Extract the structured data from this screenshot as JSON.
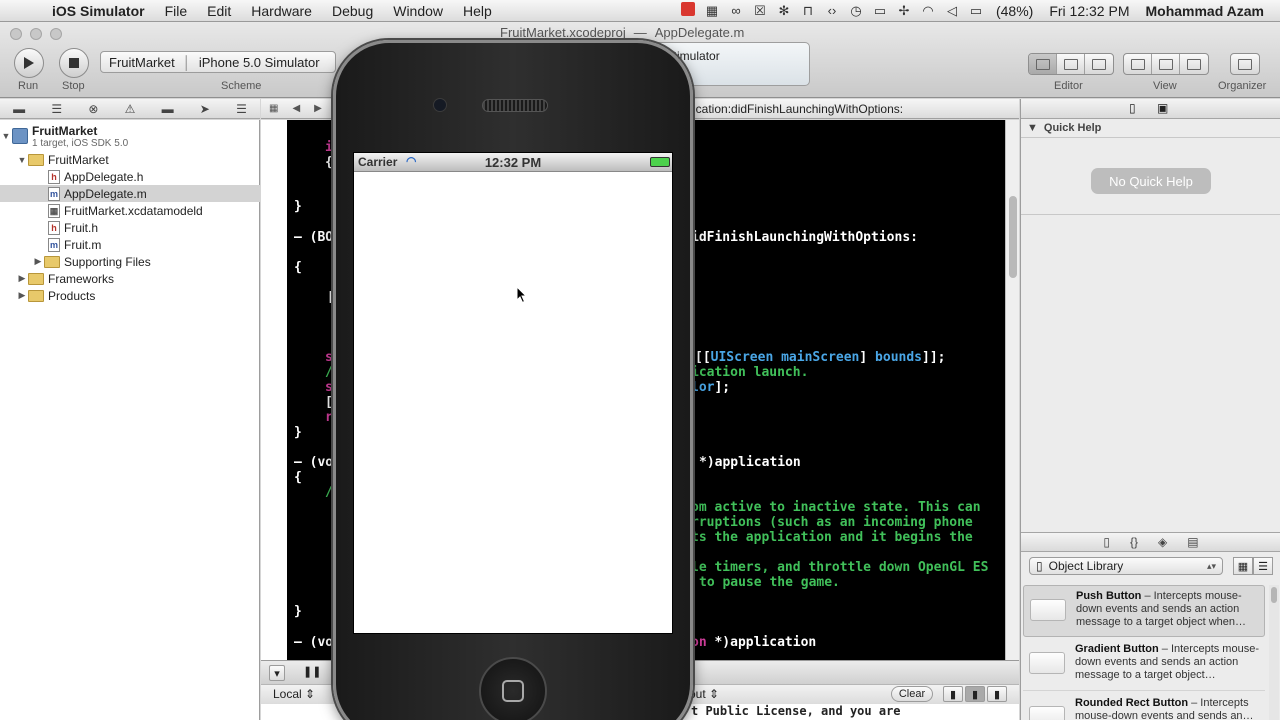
{
  "menubar": {
    "app_name": "iOS Simulator",
    "menus": [
      "File",
      "Edit",
      "Hardware",
      "Debug",
      "Window",
      "Help"
    ],
    "battery": "(48%)",
    "clock": "Fri 12:32 PM",
    "user": "Mohammad Azam"
  },
  "toolbar": {
    "run_label": "Run",
    "stop_label": "Stop",
    "scheme_label": "Scheme",
    "scheme_target": "FruitMarket",
    "scheme_destination": "iPhone 5.0 Simulator",
    "activity_text": "5.0 Simulator",
    "doc_tab_1": "FruitMarket.xcodeproj",
    "doc_tab_sep": "—",
    "doc_tab_2": "AppDelegate.m",
    "editor_label": "Editor",
    "view_label": "View",
    "organizer_label": "Organizer"
  },
  "navigator": {
    "project_name": "FruitMarket",
    "project_sub": "1 target, iOS SDK 5.0",
    "group_name": "FruitMarket",
    "files": [
      {
        "name": "AppDelegate.h",
        "kind": "h"
      },
      {
        "name": "AppDelegate.m",
        "kind": "m"
      },
      {
        "name": "FruitMarket.xcdatamodeld",
        "kind": "d"
      },
      {
        "name": "Fruit.h",
        "kind": "h"
      },
      {
        "name": "Fruit.m",
        "kind": "m"
      }
    ],
    "supporting_files": "Supporting Files",
    "frameworks": "Frameworks",
    "products": "Products"
  },
  "editor": {
    "jump_path": "ication:didFinishLaunchingWithOptions:",
    "code": {
      "l_brace1": "}",
      "l_method1": "– (BO",
      "l_didfinish": "idFinishLaunchingWithOptions:",
      "l_open1": "{",
      "l_bracket": "[",
      "l_screen_open": "[[",
      "l_screen_class": "UIScreen",
      "l_screen_msg": "mainScreen",
      "l_screen_close": "]",
      "l_screen_bounds": "bounds",
      "l_screen_end": "]];",
      "l_comment_launch": "ication launch.",
      "l_color_part": "lor",
      "l_color_end": "];",
      "l_brace2": "}",
      "l_method2": "– (vo",
      "l_app1": "*)application",
      "l_open2": "{",
      "l_c1": "om active to inactive state. This can",
      "l_c2": "rruptions (such as an incoming phone",
      "l_c3": "ts the application and it begins the",
      "l_c4": "le timers, and throttle down OpenGL ES",
      "l_c5": "to pause the game.",
      "l_brace3": "}",
      "l_method3": "– (vo",
      "l_app2_kw": "on",
      "l_app2": "*)application"
    }
  },
  "debug": {
    "local_label": "Local ⇕",
    "out_label": "out ⇕",
    "clear_label": "Clear",
    "license_line": "t Public License, and you are"
  },
  "utilities": {
    "quick_help_title": "Quick Help",
    "no_quick_help": "No Quick Help",
    "library_select": "Object Library",
    "library_items": [
      {
        "title": "Push Button",
        "desc": " – Intercepts mouse-down events and sends an action message to a target object when…"
      },
      {
        "title": "Gradient Button",
        "desc": " – Intercepts mouse-down events and sends an action message to a target object…"
      },
      {
        "title": "Rounded Rect Button",
        "desc": " – Intercepts mouse-down events and sends an…"
      }
    ]
  },
  "simulator": {
    "carrier": "Carrier",
    "time": "12:32 PM"
  }
}
